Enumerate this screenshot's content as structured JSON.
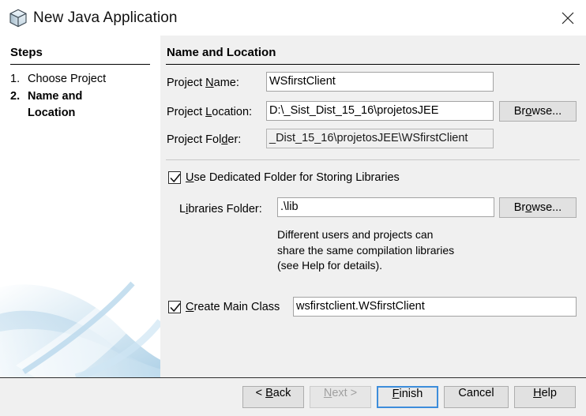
{
  "window": {
    "title": "New Java Application",
    "icon": "java-cube-icon",
    "close_label": "✕",
    "accent_color": "#3d8ddb",
    "panel_background": "#f0f0f0",
    "steps_background": "#ffffff"
  },
  "steps": {
    "heading": "Steps",
    "items": [
      {
        "number": "1.",
        "label": "Choose Project",
        "current": false
      },
      {
        "number": "2.",
        "label": "Name and\nLocation",
        "current": true
      }
    ]
  },
  "main": {
    "heading": "Name and Location",
    "project_name": {
      "label_pre": "Project ",
      "label_mnemonic": "N",
      "label_post": "ame:",
      "value": "WSfirstClient"
    },
    "project_location": {
      "label_pre": "Project ",
      "label_mnemonic": "L",
      "label_post": "ocation:",
      "value": "D:\\_Sist_Dist_15_16\\projetosJEE",
      "browse_pre": "Br",
      "browse_mnemonic": "o",
      "browse_post": "wse..."
    },
    "project_folder": {
      "label_pre": "Project Fol",
      "label_mnemonic": "d",
      "label_post": "er:",
      "value": "_Dist_15_16\\projetosJEE\\WSfirstClient"
    },
    "use_dedicated_folder": {
      "checked": true,
      "label_pre": "",
      "label_mnemonic": "U",
      "label_post": "se Dedicated Folder for Storing Libraries"
    },
    "libraries_folder": {
      "label_pre": "L",
      "label_mnemonic": "i",
      "label_post": "braries Folder:",
      "value": ".\\lib",
      "browse_pre": "Br",
      "browse_mnemonic": "o",
      "browse_post": "wse..."
    },
    "hint_text": "Different users and projects can\nshare the same compilation libraries\n(see Help for details).",
    "create_main_class": {
      "checked": true,
      "label_pre": "",
      "label_mnemonic": "C",
      "label_post": "reate Main Class",
      "value": "wsfirstclient.WSfirstClient"
    }
  },
  "buttons": {
    "back": {
      "pre": "< ",
      "mnemonic": "B",
      "post": "ack",
      "state": "enabled"
    },
    "next": {
      "pre": "",
      "mnemonic": "N",
      "post": "ext >",
      "state": "disabled"
    },
    "finish": {
      "pre": "",
      "mnemonic": "F",
      "post": "inish",
      "state": "default"
    },
    "cancel": {
      "pre": "Cancel",
      "mnemonic": "",
      "post": "",
      "state": "enabled"
    },
    "help": {
      "pre": "",
      "mnemonic": "H",
      "post": "elp",
      "state": "enabled"
    }
  }
}
